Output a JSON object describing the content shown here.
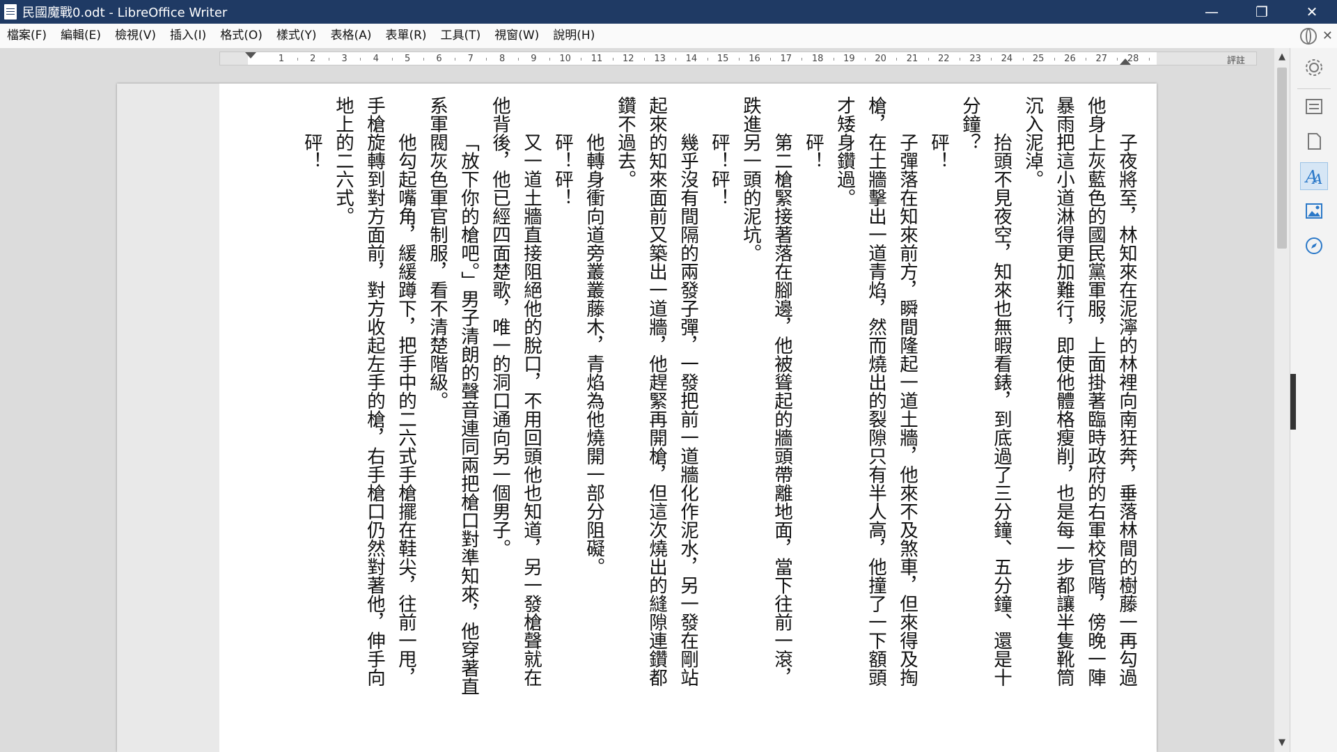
{
  "window": {
    "title": "民國魔戰0.odt - LibreOffice Writer",
    "minimize_glyph": "—",
    "maximize_glyph": "❐",
    "close_glyph": "✕"
  },
  "menu": {
    "items": [
      "檔案(F)",
      "編輯(E)",
      "檢視(V)",
      "插入(I)",
      "格式(O)",
      "樣式(Y)",
      "表格(A)",
      "表單(R)",
      "工具(T)",
      "視窗(W)",
      "說明(H)"
    ],
    "close_doc_glyph": "✕"
  },
  "ruler": {
    "numbers": [
      "1",
      "2",
      "3",
      "4",
      "5",
      "6",
      "7",
      "8",
      "9",
      "10",
      "11",
      "12",
      "13",
      "14",
      "15",
      "16",
      "17",
      "18",
      "19",
      "20",
      "21",
      "22",
      "23",
      "24",
      "25",
      "26",
      "27",
      "28"
    ],
    "comment_label": "評註"
  },
  "document": {
    "paragraphs": [
      {
        "text": "子夜將至，林知來在泥濘的林裡向南狂奔，垂落林間的樹藤一再勾過他身上灰藍色的國民黨軍服，上面掛著臨時政府的右軍校官階，傍晚一陣暴雨把這小道淋得更加難行，即使他體格瘦削，也是每一步都讓半隻靴筒沉入泥淖。",
        "indent": true
      },
      {
        "text": "抬頭不見夜空，知來也無暇看錶，到底過了三分鐘、五分鐘、還是十分鐘？",
        "indent": true
      },
      {
        "text": "砰！",
        "indent": true
      },
      {
        "text": "子彈落在知來前方，瞬間隆起一道土牆，他來不及煞車，但來得及掏槍，在土牆擊出一道青焰，然而燒出的裂隙只有半人高，他撞了一下額頭才矮身鑽過。",
        "indent": true
      },
      {
        "text": "砰！",
        "indent": true
      },
      {
        "text": "第二槍緊接著落在腳邊，他被聳起的牆頭帶離地面，當下往前一滾，跌進另一頭的泥坑。",
        "indent": true
      },
      {
        "text": "砰！砰！",
        "indent": true
      },
      {
        "text": "幾乎沒有間隔的兩發子彈，一發把前一道牆化作泥水，另一發在剛站起來的知來面前又築出一道牆，他趕緊再開槍，但這次燒出的縫隙連鑽都鑽不過去。",
        "indent": true
      },
      {
        "text": "他轉身衝向道旁叢叢藤木，青焰為他燒開一部分阻礙。",
        "indent": true
      },
      {
        "text": "砰！砰！",
        "indent": true
      },
      {
        "text": "又一道土牆直接阻絕他的脫口，不用回頭他也知道，另一發槍聲就在他背後，他已經四面楚歌，唯一的洞口通向另一個男子。",
        "indent": true
      },
      {
        "text": "「放下你的槍吧。」男子清朗的聲音連同兩把槍口對準知來，他穿著直系軍閥灰色軍官制服，看不清楚階級。",
        "indent": true
      },
      {
        "text": "他勾起嘴角，緩緩蹲下，把手中的二六式手槍擺在鞋尖，往前一甩，手槍旋轉到對方面前，對方收起左手的槍，右手槍口仍然對著他，伸手向地上的二六式。",
        "indent": true
      },
      {
        "text": "砰！",
        "indent": true
      }
    ]
  },
  "sidebar": {
    "buttons": [
      "properties",
      "styles-panel",
      "page",
      "styles",
      "gallery",
      "navigator"
    ]
  },
  "colors": {
    "titlebar": "#1f3a64",
    "accent": "#2a78c8"
  }
}
